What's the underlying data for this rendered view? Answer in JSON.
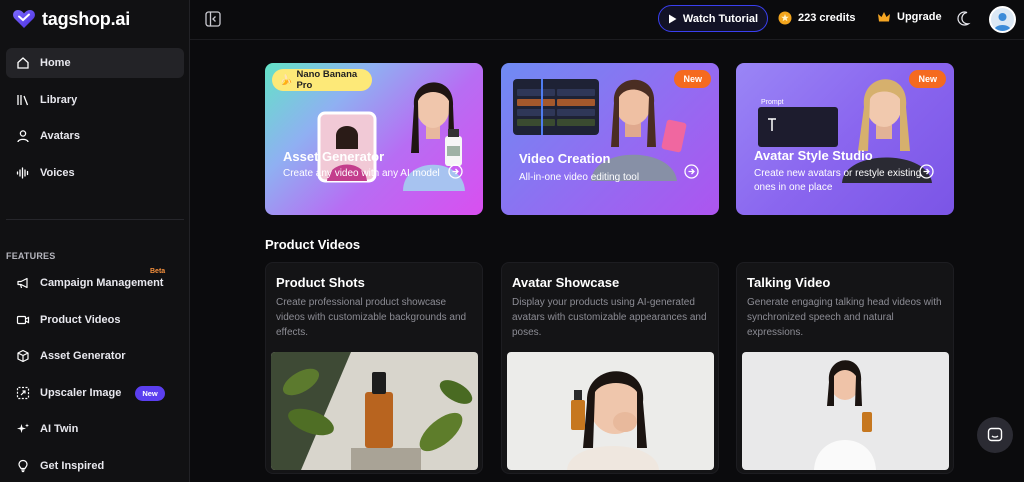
{
  "brand": {
    "name": "tagshop.ai",
    "accent": "#5b3ff0"
  },
  "sidebar": {
    "main": [
      {
        "label": "Home",
        "icon": "home-icon",
        "active": true
      },
      {
        "label": "Library",
        "icon": "library-icon"
      },
      {
        "label": "Avatars",
        "icon": "user-icon"
      },
      {
        "label": "Voices",
        "icon": "waveform-icon"
      }
    ],
    "features_label": "FEATURES",
    "features": [
      {
        "label": "Campaign Management",
        "icon": "megaphone-icon",
        "tag": "Beta"
      },
      {
        "label": "Product Videos",
        "icon": "video-camera-icon"
      },
      {
        "label": "Asset Generator",
        "icon": "cube-icon"
      },
      {
        "label": "Upscaler Image",
        "icon": "upscale-icon",
        "badge": "New"
      },
      {
        "label": "AI Twin",
        "icon": "sparkle-icon"
      },
      {
        "label": "Get Inspired",
        "icon": "lightbulb-icon"
      }
    ]
  },
  "topbar": {
    "watch_label": "Watch Tutorial",
    "credits_label": "223 credits",
    "upgrade_label": "Upgrade"
  },
  "feature_cards": [
    {
      "title": "Asset Generator",
      "desc": "Create any video with any AI model",
      "chip": "Nano Banana Pro",
      "gradient": [
        "#5ae8c8",
        "#b86ef5",
        "#e24ef0"
      ]
    },
    {
      "title": "Video Creation",
      "desc": "All-in-one video editing tool",
      "badge": "New",
      "gradient": [
        "#7b8cf5",
        "#9b5cf0",
        "#b24df0"
      ]
    },
    {
      "title": "Avatar Style Studio",
      "desc": "Create new avatars or restyle existing ones in one place",
      "badge": "New",
      "label": "Prompt",
      "gradient": [
        "#8f7cf5",
        "#8a62ee",
        "#7f57e8"
      ]
    }
  ],
  "section_title": "Product Videos",
  "product_cards": [
    {
      "title": "Product Shots",
      "desc": "Create professional product showcase videos with customizable backgrounds and effects."
    },
    {
      "title": "Avatar Showcase",
      "desc": "Display your products using AI-generated avatars with customizable appearances and poses."
    },
    {
      "title": "Talking Video",
      "desc": "Generate engaging talking head videos with synchronized speech and natural expressions."
    }
  ]
}
